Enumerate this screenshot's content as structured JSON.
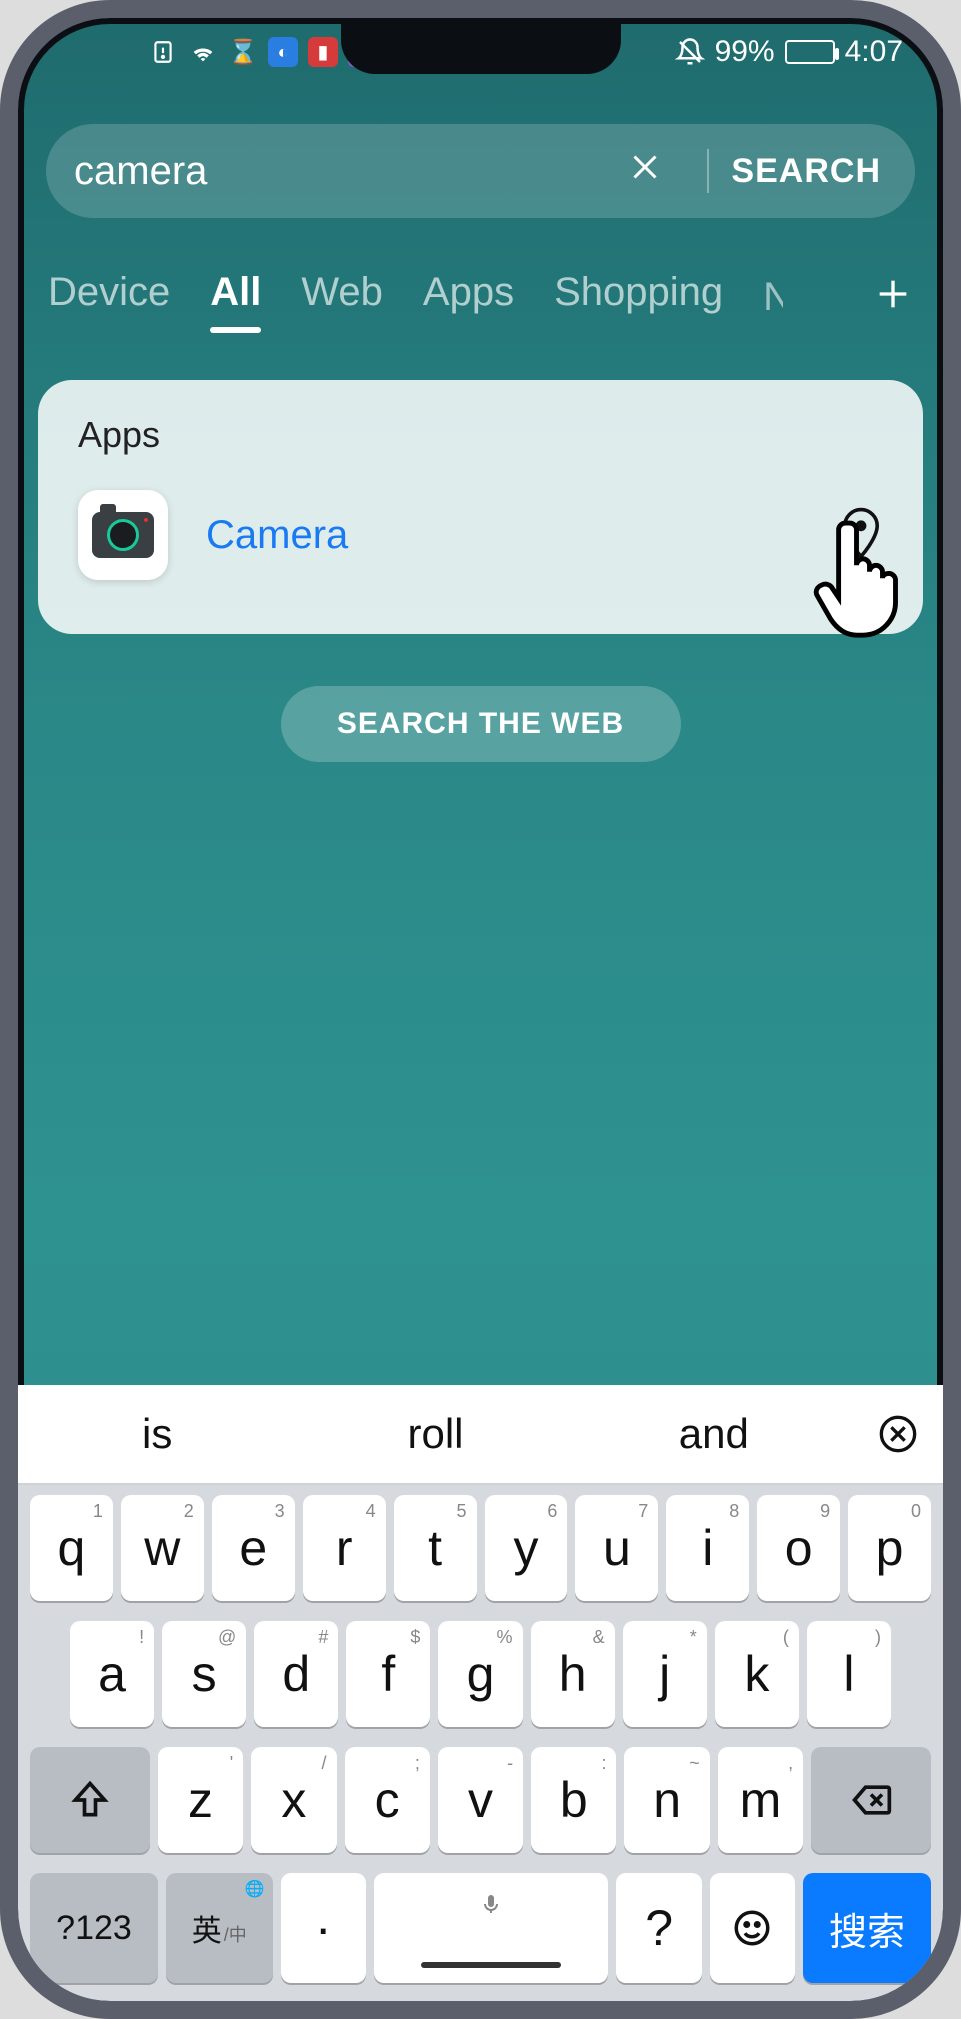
{
  "status": {
    "battery_pct": "99%",
    "time": "4:07",
    "icons": [
      "sim-alert",
      "wifi",
      "hourglass",
      "browser",
      "book",
      "music"
    ],
    "alarm_off": true
  },
  "search": {
    "value": "camera",
    "button": "SEARCH"
  },
  "tabs": {
    "items": [
      "Device",
      "All",
      "Web",
      "Apps",
      "Shopping"
    ],
    "active_index": 1,
    "more_initial": "N"
  },
  "results": {
    "section": "Apps",
    "app_name": "Camera"
  },
  "web_button": "SEARCH THE WEB",
  "suggestions": [
    "is",
    "roll",
    "and"
  ],
  "keyboard": {
    "row1": [
      {
        "m": "q",
        "s": "1"
      },
      {
        "m": "w",
        "s": "2"
      },
      {
        "m": "e",
        "s": "3"
      },
      {
        "m": "r",
        "s": "4"
      },
      {
        "m": "t",
        "s": "5"
      },
      {
        "m": "y",
        "s": "6"
      },
      {
        "m": "u",
        "s": "7"
      },
      {
        "m": "i",
        "s": "8"
      },
      {
        "m": "o",
        "s": "9"
      },
      {
        "m": "p",
        "s": "0"
      }
    ],
    "row2": [
      {
        "m": "a",
        "s": "!"
      },
      {
        "m": "s",
        "s": "@"
      },
      {
        "m": "d",
        "s": "#"
      },
      {
        "m": "f",
        "s": "$"
      },
      {
        "m": "g",
        "s": "%"
      },
      {
        "m": "h",
        "s": "&"
      },
      {
        "m": "j",
        "s": "*"
      },
      {
        "m": "k",
        "s": "("
      },
      {
        "m": "l",
        "s": ")"
      }
    ],
    "row3": [
      {
        "m": "z",
        "s": "'"
      },
      {
        "m": "x",
        "s": "/"
      },
      {
        "m": "c",
        "s": ";"
      },
      {
        "m": "v",
        "s": "-"
      },
      {
        "m": "b",
        "s": ":"
      },
      {
        "m": "n",
        "s": "~"
      },
      {
        "m": "m",
        "s": ","
      }
    ],
    "numkey": "?123",
    "lang_main": "英",
    "lang_sub": "/中",
    "period": "·",
    "question": "?",
    "action": "搜索"
  }
}
